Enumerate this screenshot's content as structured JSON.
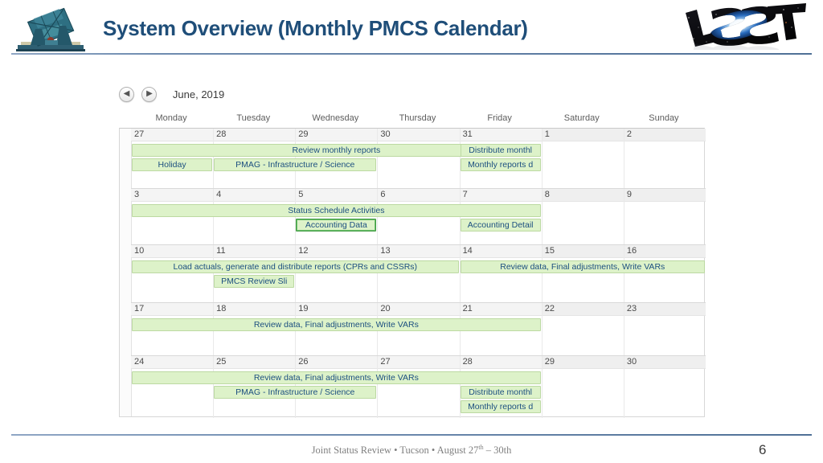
{
  "header": {
    "title": "System Overview (Monthly PMCS Calendar)",
    "left_logo": "telescope-icon",
    "right_logo": "lsst-logo",
    "title_color": "#1f4e79"
  },
  "calendar": {
    "prev_label": "◀",
    "next_label": "▶",
    "month_label": "June, 2019",
    "weekdays": [
      "Monday",
      "Tuesday",
      "Wednesday",
      "Thursday",
      "Friday",
      "Saturday",
      "Sunday"
    ],
    "event_color": "#ddf2c9",
    "event_border": "#bcd9a2",
    "event_text_color": "#1c4f80",
    "selected_border": "#3f9b3f",
    "weeks": [
      {
        "days": [
          "27",
          "28",
          "29",
          "30",
          "31",
          "1",
          "2"
        ],
        "events": [
          {
            "label": "Review monthly reports",
            "start": 0,
            "span": 5,
            "row": 0
          },
          {
            "label": "Distribute monthl",
            "start": 4,
            "span": 1,
            "row": 0,
            "clipped": true
          },
          {
            "label": "Holiday",
            "start": 0,
            "span": 1,
            "row": 1
          },
          {
            "label": "PMAG - Infrastructure / Science",
            "start": 1,
            "span": 2,
            "row": 1
          },
          {
            "label": "Monthly reports d",
            "start": 4,
            "span": 1,
            "row": 1,
            "clipped": true
          }
        ]
      },
      {
        "days": [
          "3",
          "4",
          "5",
          "6",
          "7",
          "8",
          "9"
        ],
        "events": [
          {
            "label": "Status Schedule Activities",
            "start": 0,
            "span": 5,
            "row": 0
          },
          {
            "label": "Accounting Data",
            "start": 2,
            "span": 1,
            "row": 1,
            "selected": true
          },
          {
            "label": "Accounting Detail",
            "start": 4,
            "span": 1,
            "row": 1,
            "clipped": true
          }
        ]
      },
      {
        "days": [
          "10",
          "11",
          "12",
          "13",
          "14",
          "15",
          "16"
        ],
        "events": [
          {
            "label": "Load actuals, generate and distribute reports (CPRs and CSSRs)",
            "start": 0,
            "span": 4,
            "row": 0
          },
          {
            "label": "Review data, Final adjustments, Write VARs",
            "start": 4,
            "span": 3,
            "row": 0
          },
          {
            "label": "PMCS Review Sli",
            "start": 1,
            "span": 1,
            "row": 1,
            "clipped": true
          }
        ]
      },
      {
        "days": [
          "17",
          "18",
          "19",
          "20",
          "21",
          "22",
          "23"
        ],
        "events": [
          {
            "label": "Review data, Final adjustments, Write VARs",
            "start": 0,
            "span": 5,
            "row": 0
          }
        ]
      },
      {
        "days": [
          "24",
          "25",
          "26",
          "27",
          "28",
          "29",
          "30"
        ],
        "events": [
          {
            "label": "Review data, Final adjustments, Write VARs",
            "start": 0,
            "span": 5,
            "row": 0
          },
          {
            "label": "PMAG - Infrastructure / Science",
            "start": 1,
            "span": 2,
            "row": 1
          },
          {
            "label": "Distribute monthl",
            "start": 4,
            "span": 1,
            "row": 1,
            "clipped": true
          },
          {
            "label": "Monthly reports d",
            "start": 4,
            "span": 1,
            "row": 2,
            "clipped": true
          }
        ]
      }
    ]
  },
  "footer": {
    "text_before": "Joint Status Review • Tucson  • August 27",
    "superscript": "th",
    "text_after": " – 30th",
    "slide_number": "6"
  }
}
